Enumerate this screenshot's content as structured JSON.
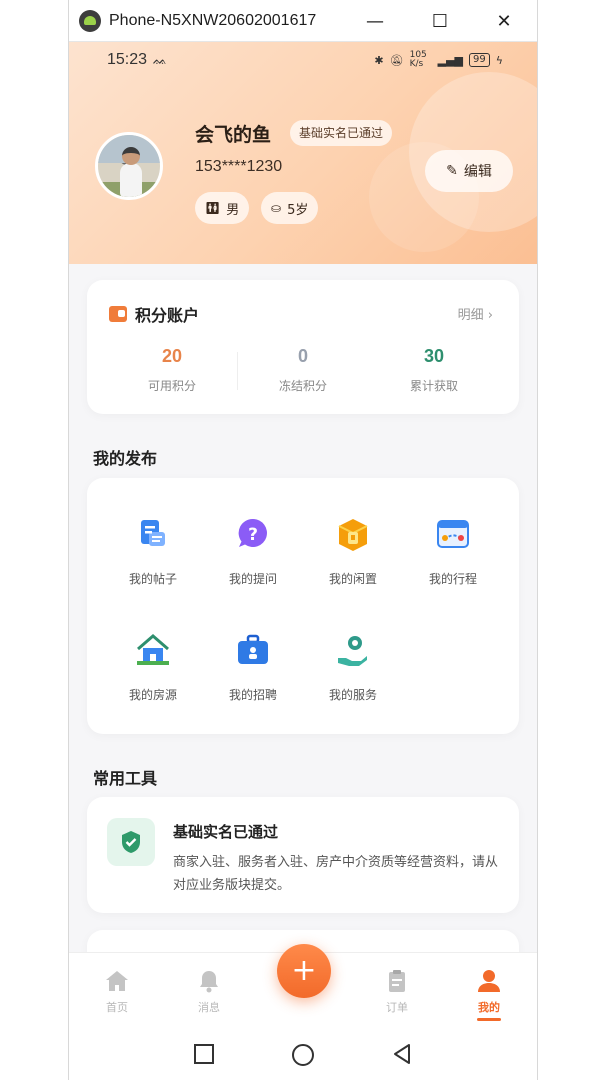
{
  "window": {
    "title": "Phone-N5XNW20602001617"
  },
  "status_bar": {
    "time": "15:23",
    "net_speed": "105 K/s",
    "battery": "99"
  },
  "profile": {
    "name": "会飞的鱼",
    "verify_badge": "基础实名已通过",
    "phone": "153****1230",
    "gender": "男",
    "age": "5岁",
    "edit_label": "编辑"
  },
  "points": {
    "title": "积分账户",
    "detail_label": "明细",
    "stats": [
      {
        "value": "20",
        "label": "可用积分",
        "color": "#e8844a"
      },
      {
        "value": "0",
        "label": "冻结积分",
        "color": "#98a0ad"
      },
      {
        "value": "30",
        "label": "累计获取",
        "color": "#2e8f6e"
      }
    ]
  },
  "my_posts": {
    "title": "我的发布",
    "items": [
      {
        "label": "我的帖子",
        "icon": "document-icon"
      },
      {
        "label": "我的提问",
        "icon": "question-icon"
      },
      {
        "label": "我的闲置",
        "icon": "box-icon"
      },
      {
        "label": "我的行程",
        "icon": "route-icon"
      },
      {
        "label": "我的房源",
        "icon": "house-icon"
      },
      {
        "label": "我的招聘",
        "icon": "briefcase-icon"
      },
      {
        "label": "我的服务",
        "icon": "service-icon"
      }
    ]
  },
  "tools": {
    "title": "常用工具",
    "verify_title": "基础实名已通过",
    "verify_desc": "商家入驻、服务者入驻、房产中介资质等经营资料，请从对应业务版块提交。"
  },
  "tabbar": {
    "items": [
      {
        "label": "首页",
        "icon": "home-icon"
      },
      {
        "label": "消息",
        "icon": "bell-icon"
      },
      {
        "label": "订单",
        "icon": "clipboard-icon"
      },
      {
        "label": "我的",
        "icon": "person-icon",
        "active": true
      }
    ],
    "fab_label": "+"
  },
  "colors": {
    "accent": "#f26a2a",
    "green": "#2e8f6e"
  }
}
